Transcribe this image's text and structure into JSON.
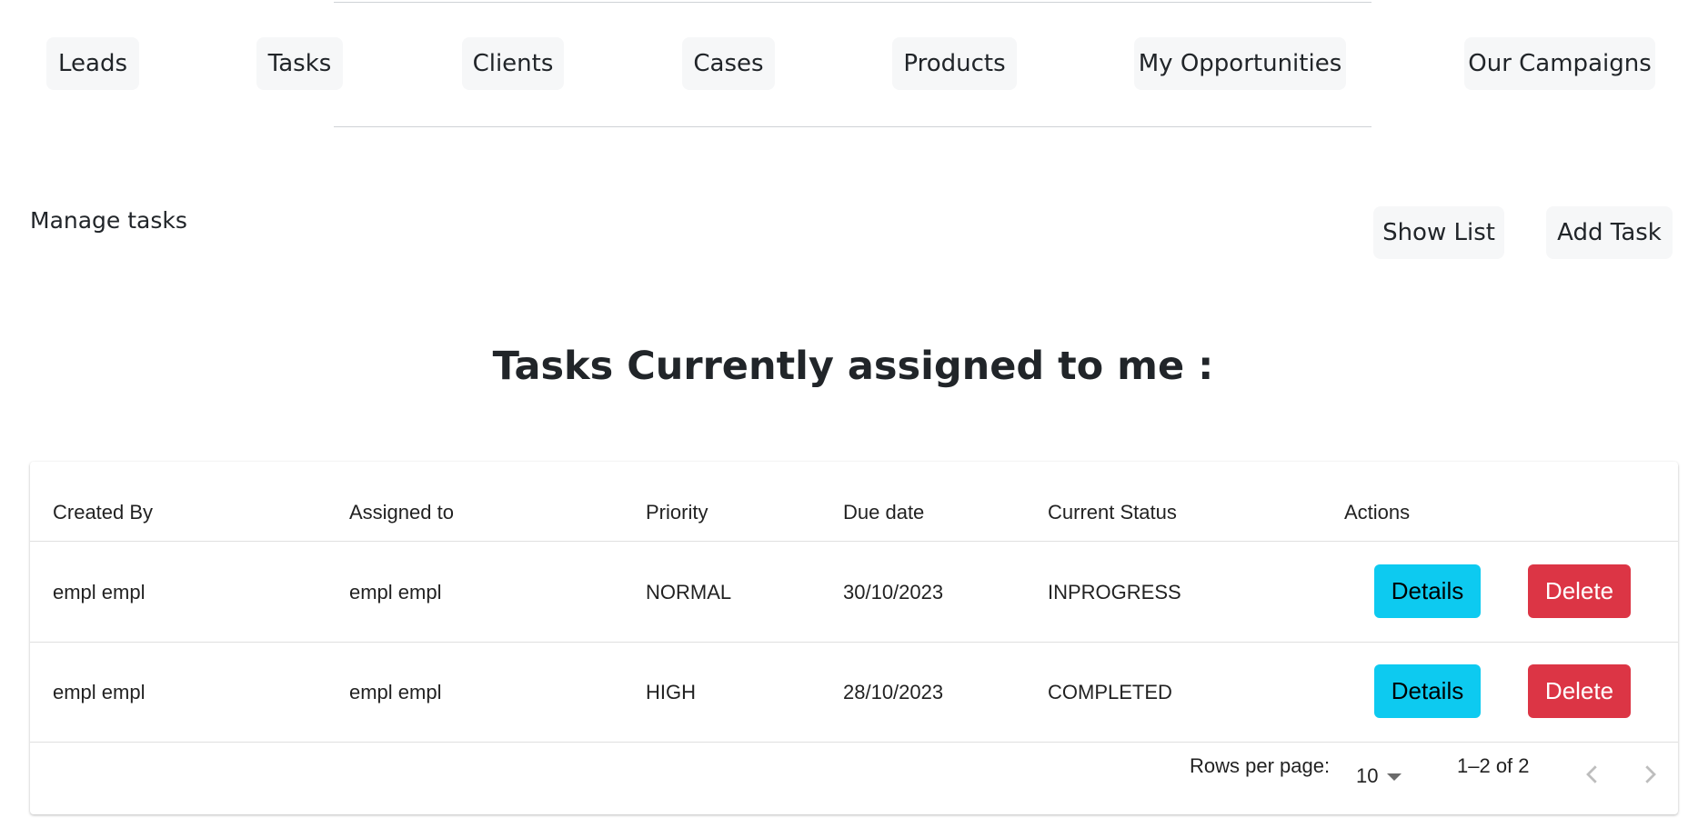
{
  "nav": {
    "items": [
      {
        "label": "Leads"
      },
      {
        "label": "Tasks"
      },
      {
        "label": "Clients"
      },
      {
        "label": "Cases"
      },
      {
        "label": "Products"
      },
      {
        "label": "My Opportunities"
      },
      {
        "label": "Our Campaigns"
      }
    ]
  },
  "section": {
    "title": "Manage tasks",
    "show_list_label": "Show List",
    "add_task_label": "Add Task"
  },
  "heading": "Tasks Currently assigned to me :",
  "table": {
    "columns": [
      "Created By",
      "Assigned to",
      "Priority",
      "Due date",
      "Current Status",
      "Actions"
    ],
    "rows": [
      {
        "created_by": "empl empl",
        "assigned_to": "empl empl",
        "priority": "NORMAL",
        "due_date": "30/10/2023",
        "status": "INPROGRESS",
        "details_label": "Details",
        "delete_label": "Delete"
      },
      {
        "created_by": "empl empl",
        "assigned_to": "empl empl",
        "priority": "HIGH",
        "due_date": "28/10/2023",
        "status": "COMPLETED",
        "details_label": "Details",
        "delete_label": "Delete"
      }
    ]
  },
  "pagination": {
    "rows_per_page_label": "Rows per page:",
    "rows_per_page_value": "10",
    "range": "1–2 of 2",
    "prev_icon": "chevron-left-icon",
    "next_icon": "chevron-right-icon"
  },
  "colors": {
    "details_button": "#0dcaf0",
    "delete_button": "#dc3545",
    "nav_pill_bg": "#f6f7f8"
  }
}
